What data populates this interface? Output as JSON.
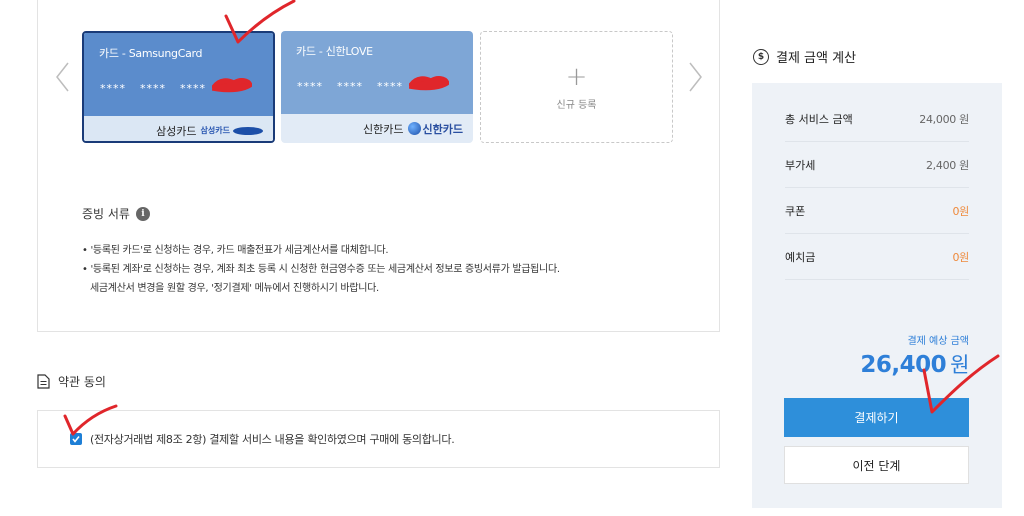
{
  "cards": [
    {
      "name": "카드 - SamsungCard",
      "number_groups": [
        "****",
        "****",
        "****"
      ],
      "issuer": "삼성카드",
      "logo_text": "삼성카드",
      "selected": true
    },
    {
      "name": "카드 - 신한LOVE",
      "number_groups": [
        "****",
        "****",
        "****"
      ],
      "issuer": "신한카드",
      "logo_text": "신한카드",
      "selected": false
    }
  ],
  "new_card": {
    "label": "신규 등록"
  },
  "proof": {
    "title": "증빙 서류",
    "notes": [
      "• '등록된 카드'로 신청하는 경우, 카드 매출전표가 세금계산서를 대체합니다.",
      "• '등록된 계좌'로 신청하는 경우, 계좌 최초 등록 시 신청한 현금영수증 또는 세금계산서 정보로 증빙서류가 발급됩니다.",
      "세금계산서 변경을 원할 경우, '정기결제' 메뉴에서 진행하시기 바랍니다."
    ]
  },
  "terms": {
    "title": "약관 동의",
    "agreement_text": "(전자상거래법 제8조 2항) 결제할 서비스 내용을 확인하였으며 구매에 동의합니다.",
    "checked": true
  },
  "calculation": {
    "title": "결제 금액 계산",
    "rows": [
      {
        "label": "총 서비스 금액",
        "value": "24,000 원",
        "highlight": false
      },
      {
        "label": "부가세",
        "value": "2,400 원",
        "highlight": false
      },
      {
        "label": "쿠폰",
        "value": "0원",
        "highlight": true
      },
      {
        "label": "예치금",
        "value": "0원",
        "highlight": true
      }
    ],
    "expected_label": "결제 예상 금액",
    "expected_amount": "26,400",
    "currency": "원",
    "pay_label": "결제하기",
    "prev_label": "이전 단계"
  },
  "colors": {
    "accent": "#2e8fda",
    "highlight_orange": "#ef8a3c",
    "annotation_red": "#e0262b"
  }
}
